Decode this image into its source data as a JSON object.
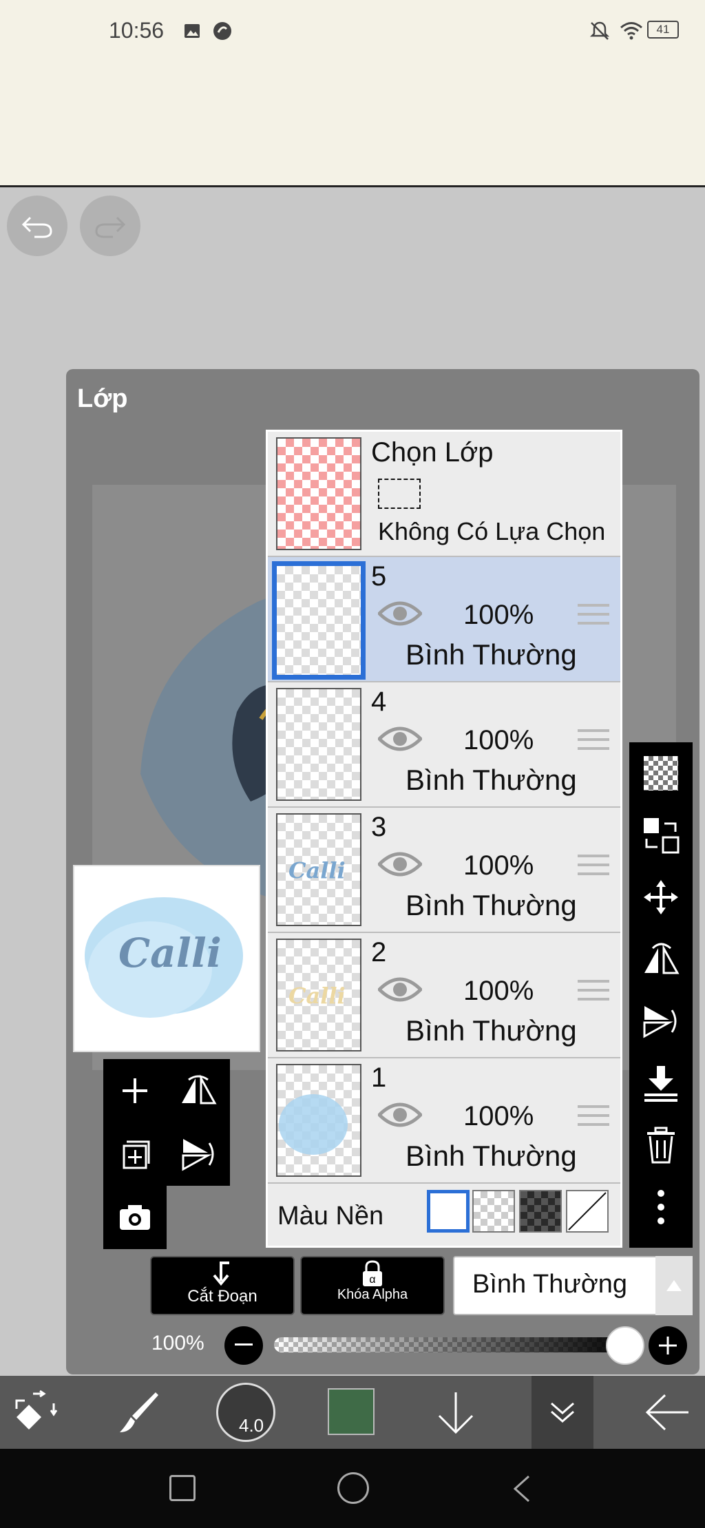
{
  "status_bar": {
    "time": "10:56",
    "battery": "41"
  },
  "dialog": {
    "title": "Lớp"
  },
  "selection_row": {
    "title": "Chọn Lớp",
    "subtitle": "Không Có Lựa Chọn"
  },
  "layers": [
    {
      "number": "5",
      "opacity": "100%",
      "blend": "Bình Thường",
      "selected": true
    },
    {
      "number": "4",
      "opacity": "100%",
      "blend": "Bình Thường",
      "selected": false
    },
    {
      "number": "3",
      "opacity": "100%",
      "blend": "Bình Thường",
      "selected": false
    },
    {
      "number": "2",
      "opacity": "100%",
      "blend": "Bình Thường",
      "selected": false
    },
    {
      "number": "1",
      "opacity": "100%",
      "blend": "Bình Thường",
      "selected": false
    }
  ],
  "background": {
    "label": "Màu Nền"
  },
  "preview": {
    "text": "Calli"
  },
  "controls": {
    "clipping_label": "Cắt Đoạn",
    "alpha_lock_label": "Khóa Alpha",
    "blend_mode": "Bình Thường",
    "opacity": "100%"
  },
  "bottom_toolbar": {
    "brush_size": "4.0",
    "color": "#3f6b47"
  },
  "colors": {
    "accent": "#2b6fd6",
    "selected_row": "#c9d6ec"
  }
}
